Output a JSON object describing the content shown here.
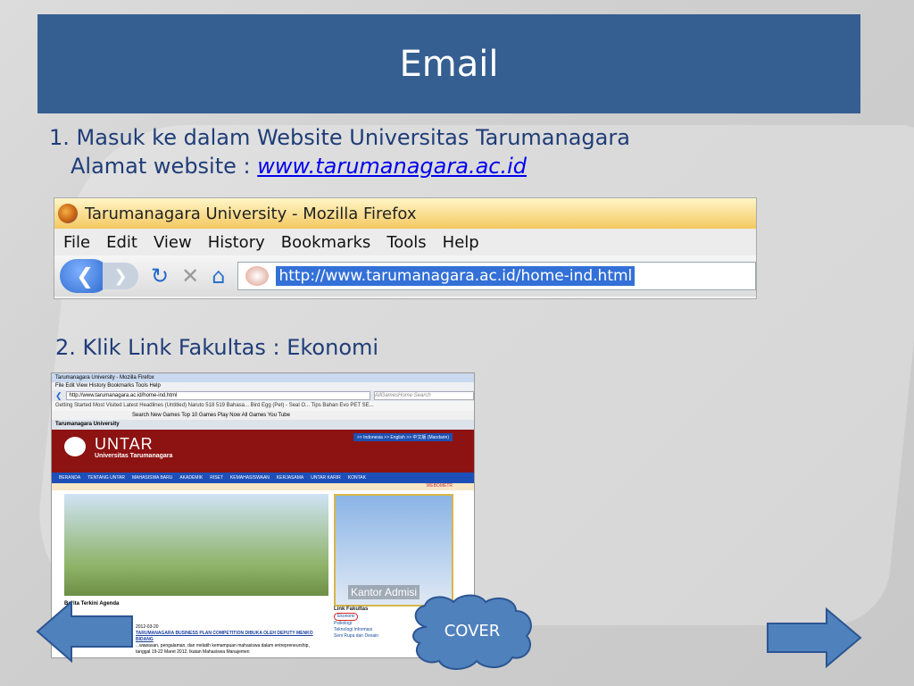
{
  "slide": {
    "title": "Email",
    "step1_line1": "1. Masuk ke dalam Website Universitas Tarumanagara",
    "step1_line2_prefix": "Alamat website : ",
    "step1_url": "www.tarumanagara.ac.id",
    "step2": "2. Klik Link Fakultas : Ekonomi",
    "cover_label": "COVER"
  },
  "firefox": {
    "window_title": "Tarumanagara University - Mozilla Firefox",
    "menu": [
      "File",
      "Edit",
      "View",
      "History",
      "Bookmarks",
      "Tools",
      "Help"
    ],
    "url": "http://www.tarumanagara.ac.id/home-ind.html"
  },
  "screenshot": {
    "title": "Tarumanagara University - Mozilla Firefox",
    "menu": "File  Edit  View  History  Bookmarks  Tools  Help",
    "url": "http://www.tarumanagara.ac.id/home-ind.html",
    "search_placeholder": "AllGamesHome Search",
    "bookmarks": "Getting Started   Most Visited   Latest Headlines   (Untitled)   Naruto 518 519 Bahasa...   Bird Egg (Pet) - Seal O...   Tips Bahan Evo PET SE...",
    "toolbar": "Search   New Games   Top 10 Games   Play Now   All Games   You Tube",
    "tab": "Tarumanagara University",
    "brand": "UNTAR",
    "brand_sub": "Universitas Tarumanagara",
    "languages": ">> Indonesia  >> English  >> 中文版 (Mandarin)",
    "nav": [
      "BERANDA",
      "TENTANG UNTAR",
      "MAHASISWA BARU",
      "AKADEMIK",
      "RISET",
      "KEMAHASISWAAN",
      "KERJASAMA",
      "UNTAR KARIR",
      "KONTAK"
    ],
    "webometr": "WEBOMETR",
    "kantor": "Kantor Admisi",
    "news_tabs": "Berita Terkini   Agenda",
    "link_header": "Link Fakultas",
    "links": [
      "Ekonomi",
      "Psikologi",
      "Teknologi Informasi",
      "Seni Rupa dan Desain"
    ],
    "news_date": "2012-03-20",
    "news_headline": "TARUMANAGARA BUSINESS PLAN COMPETITION DIBUKA OLEH DEPUTY MENKO",
    "news_sub": "BIDANG",
    "news_text": "...wawasan, pengalaman, dan melatih kemampuan mahasiswa dalam entrepreneurship, tanggal 19-22 Maret 2012, Ikatan Mahasiswa Manajemen"
  },
  "colors": {
    "title_bar": "#365f91",
    "text": "#1f3d78",
    "arrow": "#4f81bd",
    "cloud": "#4f81bd"
  },
  "icons": [
    "back-arrow-icon",
    "forward-arrow-icon",
    "reload-icon",
    "stop-icon",
    "home-icon",
    "left-arrow-icon",
    "right-arrow-icon",
    "cloud-icon"
  ]
}
